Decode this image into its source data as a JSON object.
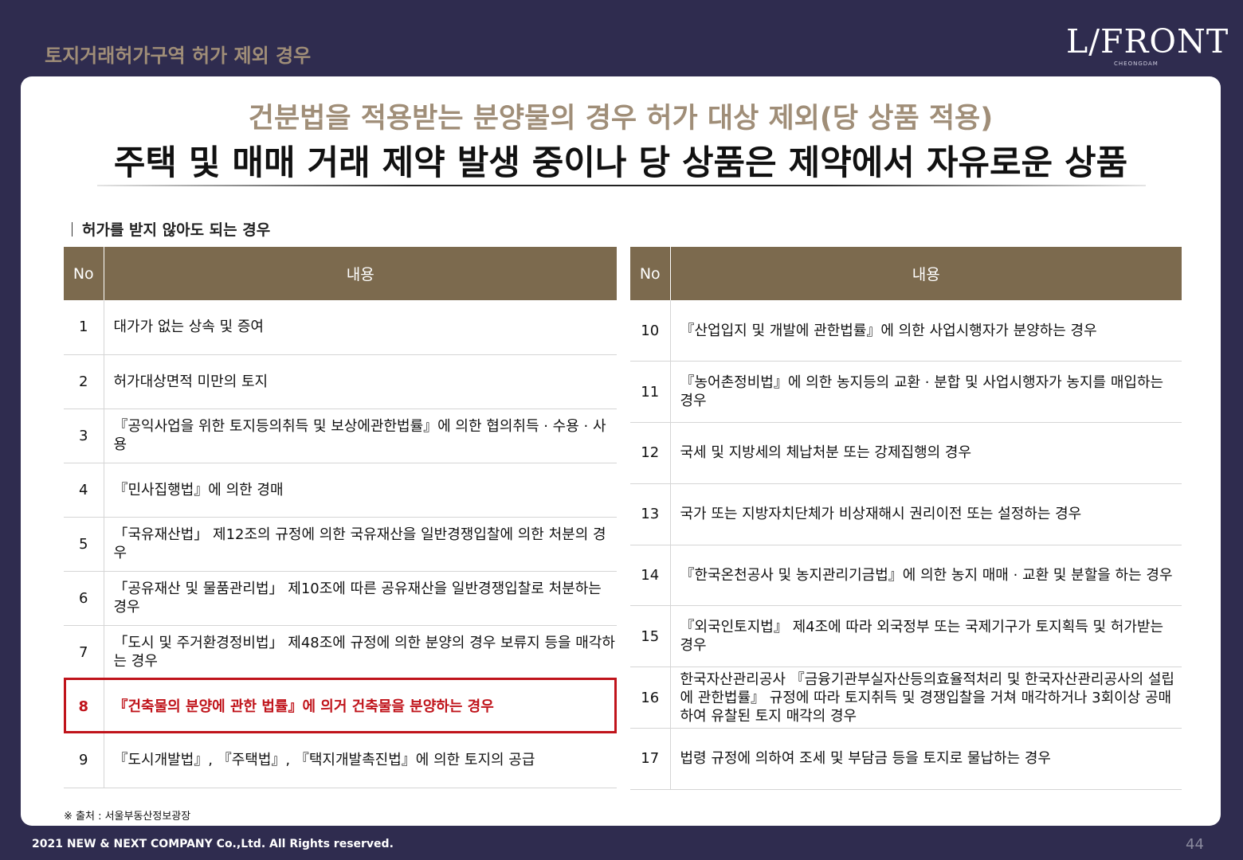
{
  "header": {
    "title": "토지거래허가구역 허가 제외 경우",
    "logo_main": "L/FRONT",
    "logo_sub": "CHEONGDAM"
  },
  "main": {
    "subtitle": "건분법을 적용받는 분양물의 경우 허가 대상 제외(당 상품 적용)",
    "headline": "주택 및 매매 거래 제약 발생 중이나 당 상품은 제약에서 자유로운 상품",
    "section_label": "허가를 받지 않아도 되는 경우",
    "table_headers": {
      "no": "No",
      "content": "내용"
    },
    "left_rows": [
      {
        "no": "1",
        "text": "대가가 없는 상속 및 증여"
      },
      {
        "no": "2",
        "text": "허가대상면적 미만의 토지"
      },
      {
        "no": "3",
        "text": "『공익사업을 위한 토지등의취득 및 보상에관한법률』에 의한 협의취득 · 수용 · 사용"
      },
      {
        "no": "4",
        "text": "『민사집행법』에 의한 경매"
      },
      {
        "no": "5",
        "text": "「국유재산법」 제12조의 규정에 의한 국유재산을 일반경쟁입찰에 의한 처분의 경우"
      },
      {
        "no": "6",
        "text": "「공유재산 및 물품관리법」 제10조에 따른 공유재산을 일반경쟁입찰로 처분하는 경우"
      },
      {
        "no": "7",
        "text": "「도시 및 주거환경정비법」 제48조에 규정에 의한 분양의 경우 보류지 등을 매각하는 경우"
      },
      {
        "no": "8",
        "text": "『건축물의 분양에 관한 법률』에 의거 건축물을 분양하는 경우"
      },
      {
        "no": "9",
        "text": "『도시개발법』, 『주택법』, 『택지개발촉진법』에 의한 토지의 공급"
      }
    ],
    "right_rows": [
      {
        "no": "10",
        "text": "『산업입지 및 개발에 관한법률』에 의한 사업시행자가 분양하는 경우"
      },
      {
        "no": "11",
        "text": "『농어촌정비법』에 의한 농지등의 교환 · 분합 및 사업시행자가 농지를 매입하는 경우"
      },
      {
        "no": "12",
        "text": "국세 및 지방세의 체납처분 또는 강제집행의 경우"
      },
      {
        "no": "13",
        "text": "국가 또는 지방자치단체가 비상재해시 권리이전 또는 설정하는 경우"
      },
      {
        "no": "14",
        "text": "『한국온천공사 및 농지관리기금법』에 의한 농지 매매 · 교환 및 분할을 하는 경우"
      },
      {
        "no": "15",
        "text": "『외국인토지법』 제4조에 따라 외국정부 또는 국제기구가 토지획득 및 허가받는 경우"
      },
      {
        "no": "16",
        "text": "한국자산관리공사 『금융기관부실자산등의효율적처리 및 한국자산관리공사의 설립에 관한법률』 규정에 따라 토지취득 및 경쟁입찰을 거쳐 매각하거나 3회이상 공매하여 유찰된 토지 매각의 경우"
      },
      {
        "no": "17",
        "text": "법령 규정에 의하여 조세 및 부담금 등을 토지로 물납하는 경우"
      }
    ],
    "highlight_no": "8",
    "source": "※ 출처 : 서울부동산정보광장"
  },
  "footer": {
    "copyright": "2021 NEW & NEXT COMPANY Co.,Ltd. All Rights reserved.",
    "page_number": "44"
  },
  "colors": {
    "background": "#2f2c4f",
    "accent_gold": "#a08e78",
    "table_header": "#7c6a4e",
    "highlight_red": "#c0141b"
  }
}
